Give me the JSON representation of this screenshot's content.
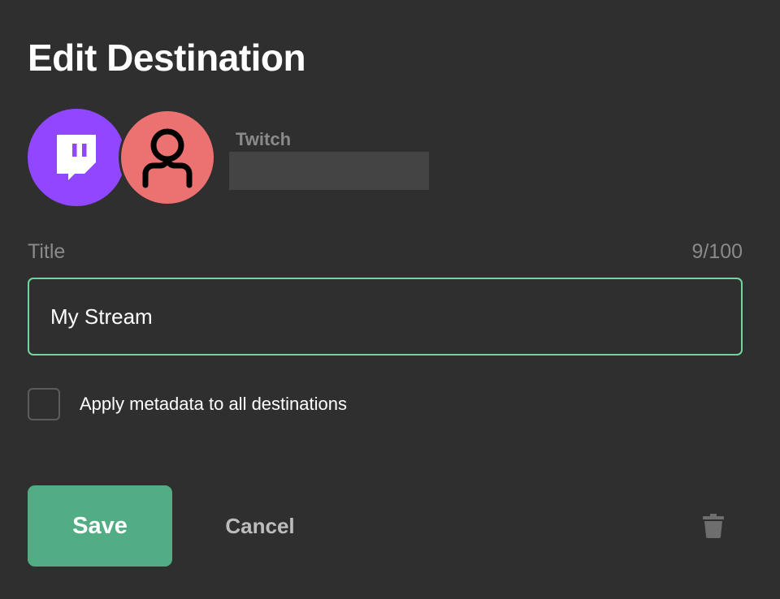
{
  "dialog": {
    "title": "Edit Destination"
  },
  "destination": {
    "platform": "Twitch",
    "platform_icon": "twitch-logo-icon",
    "account_avatar_icon": "user-avatar-icon",
    "account_name": ""
  },
  "form": {
    "title_label": "Title",
    "title_value": "My Stream",
    "title_counter": "9/100",
    "apply_all_label": "Apply metadata to all destinations",
    "apply_all_checked": false
  },
  "actions": {
    "save_label": "Save",
    "cancel_label": "Cancel",
    "delete_icon": "trash-icon"
  },
  "colors": {
    "background": "#2f2f2f",
    "twitch_purple": "#9146ff",
    "avatar_red": "#ec7272",
    "accent_green": "#52ad85",
    "focus_border": "#72d5a0"
  }
}
